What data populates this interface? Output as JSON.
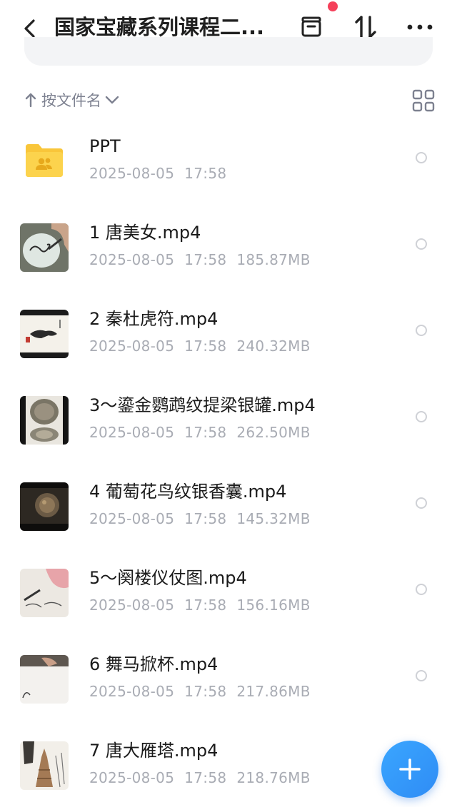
{
  "header": {
    "title": "国家宝藏系列课程二...",
    "icons": [
      "back-arrow-icon",
      "archive-box-icon",
      "sort-arrows-icon",
      "more-dots-icon"
    ]
  },
  "sort": {
    "label": "按文件名",
    "icons": [
      "sort-up-arrow-icon",
      "chevron-down-icon",
      "grid-view-icon"
    ]
  },
  "colors": {
    "accent": "#2f8cf5",
    "notification_dot": "#f5405a",
    "folder": "#fcd34d",
    "text_secondary": "#a9acb4"
  },
  "files": [
    {
      "name": "PPT",
      "date": "2025-08-05",
      "time": "17:58",
      "size": "",
      "kind": "folder"
    },
    {
      "name": "1 唐美女.mp4",
      "date": "2025-08-05",
      "time": "17:58",
      "size": "185.87MB",
      "kind": "video"
    },
    {
      "name": "2 秦杜虎符.mp4",
      "date": "2025-08-05",
      "time": "17:58",
      "size": "240.32MB",
      "kind": "video"
    },
    {
      "name": "3～鎏金鹦鹉纹提梁银罐.mp4",
      "date": "2025-08-05",
      "time": "17:58",
      "size": "262.50MB",
      "kind": "video"
    },
    {
      "name": "4 葡萄花鸟纹银香囊.mp4",
      "date": "2025-08-05",
      "time": "17:58",
      "size": "145.32MB",
      "kind": "video"
    },
    {
      "name": "5～阕楼仪仗图.mp4",
      "date": "2025-08-05",
      "time": "17:58",
      "size": "156.16MB",
      "kind": "video"
    },
    {
      "name": "6 舞马掀杯.mp4",
      "date": "2025-08-05",
      "time": "17:58",
      "size": "217.86MB",
      "kind": "video"
    },
    {
      "name": "7 唐大雁塔.mp4",
      "date": "2025-08-05",
      "time": "17:58",
      "size": "218.76MB",
      "kind": "video"
    }
  ],
  "fab": {
    "icon": "plus-icon"
  }
}
